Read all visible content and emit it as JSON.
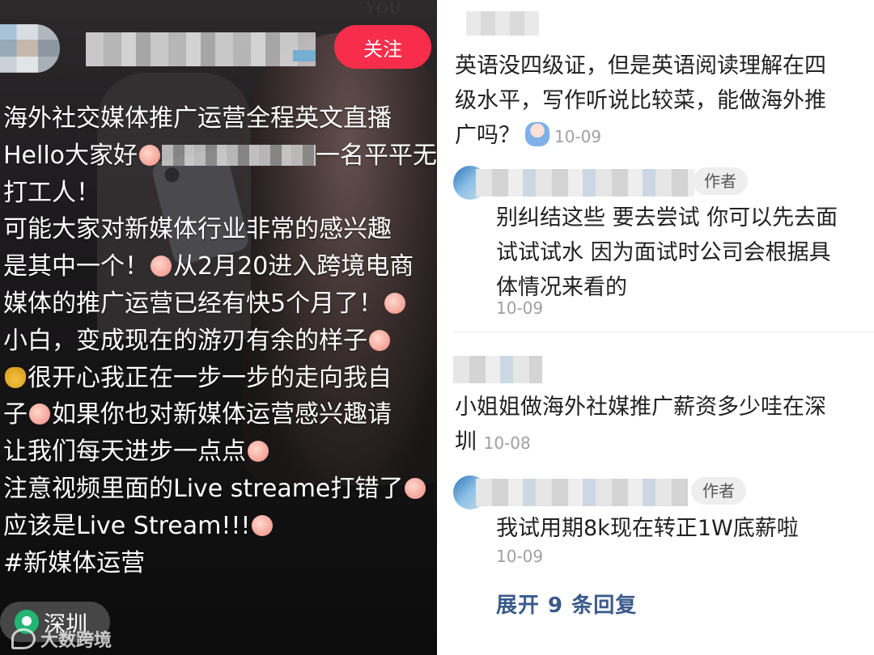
{
  "left_panel": {
    "wall_text": "YOU",
    "follow_label": "关注",
    "caption_lines": [
      {
        "parts": [
          "海外社交媒体推广运营全程英文直播"
        ]
      },
      {
        "parts": [
          "Hello大家好",
          "[emoji]",
          "[blur]",
          "一名平平无"
        ]
      },
      {
        "parts": [
          "打工人！"
        ]
      },
      {
        "parts": [
          "可能大家对新媒体行业非常的感兴趣"
        ]
      },
      {
        "parts": [
          "是其中一个！",
          "[emoji]",
          "从2月20进入跨境电商"
        ]
      },
      {
        "parts": [
          "媒体的推广运营已经有快5个月了！",
          "[emoji]"
        ]
      },
      {
        "parts": [
          "小白，变成现在的游刃有余的样子",
          "[emoji]"
        ]
      },
      {
        "parts": [
          "[bag]",
          "很开心我正在一步一步的走向我自"
        ]
      },
      {
        "parts": [
          "子",
          "[emoji]",
          "如果你也对新媒体运营感兴趣请"
        ]
      },
      {
        "parts": [
          "让我们每天进步一点点",
          "[emoji]"
        ]
      },
      {
        "parts": [
          "注意视频里面的Live streame打错了",
          "[emoji]"
        ]
      },
      {
        "parts": [
          "应该是Live Stream!!!",
          "[emoji]"
        ]
      },
      {
        "parts": [
          "#新媒体运营"
        ]
      }
    ],
    "location_label": "深圳",
    "watermark_text": "大数跨境"
  },
  "right_panel": {
    "comments": [
      {
        "lines": [
          "英语没四级证，但是英语阅读理解在四",
          "级水平，写作听说比较菜，能做海外推",
          "广吗？"
        ],
        "date": "10-09"
      },
      {
        "is_author": true,
        "author_tag": "作者",
        "lines": [
          "别纠结这些 要去尝试 你可以先去面",
          "试试试水 因为面试时公司会根据具",
          "体情况来看的"
        ],
        "date": "10-09"
      },
      {
        "lines": [
          "小姐姐做海外社媒推广薪资多少哇在深",
          "圳"
        ],
        "date": "10-08"
      },
      {
        "is_author": true,
        "author_tag": "作者",
        "lines": [
          "我试用期8k现在转正1W底薪啦"
        ],
        "date": "10-09"
      }
    ],
    "expand_label": "展开 9 条回复"
  },
  "colors": {
    "follow_button": "#f72d4b",
    "location_icon": "#22b573",
    "expand_link": "#3a5a8a",
    "date_text": "#a0a0a0"
  }
}
